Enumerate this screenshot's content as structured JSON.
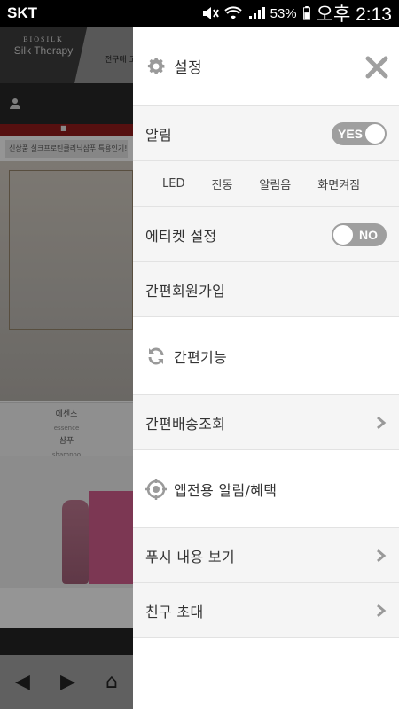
{
  "status_bar": {
    "carrier": "SKT",
    "battery": "53%",
    "time": "오후 2:13"
  },
  "background": {
    "logo_top": "BIOSILK",
    "logo_name": "Silk Therapy",
    "tab_label": "전구매 고",
    "notice": "신상품 실크프로틴클리닉샴푸 특용인기!",
    "product_1": "에센스",
    "product_1_sub": "essence",
    "product_2": "샴푸",
    "product_2_sub": "shampoo"
  },
  "drawer": {
    "title": "설정",
    "notification_label": "알림",
    "notification_toggle": "YES",
    "checks": [
      {
        "label": "LED"
      },
      {
        "label": "진동"
      },
      {
        "label": "알림음"
      },
      {
        "label": "화면켜짐"
      }
    ],
    "etiquette_label": "에티켓 설정",
    "etiquette_toggle": "NO",
    "quick_signup": "간편회원가입",
    "quick_features": "간편기능",
    "quick_delivery": "간편배송조회",
    "app_alerts": "앱전용 알림/혜택",
    "push_view": "푸시 내용 보기",
    "invite_friend": "친구 초대"
  },
  "colors": {
    "toggle_bg": "#9f9f9f",
    "section_bg": "#f5f5f5",
    "icon_gray": "#9a9a9a"
  }
}
